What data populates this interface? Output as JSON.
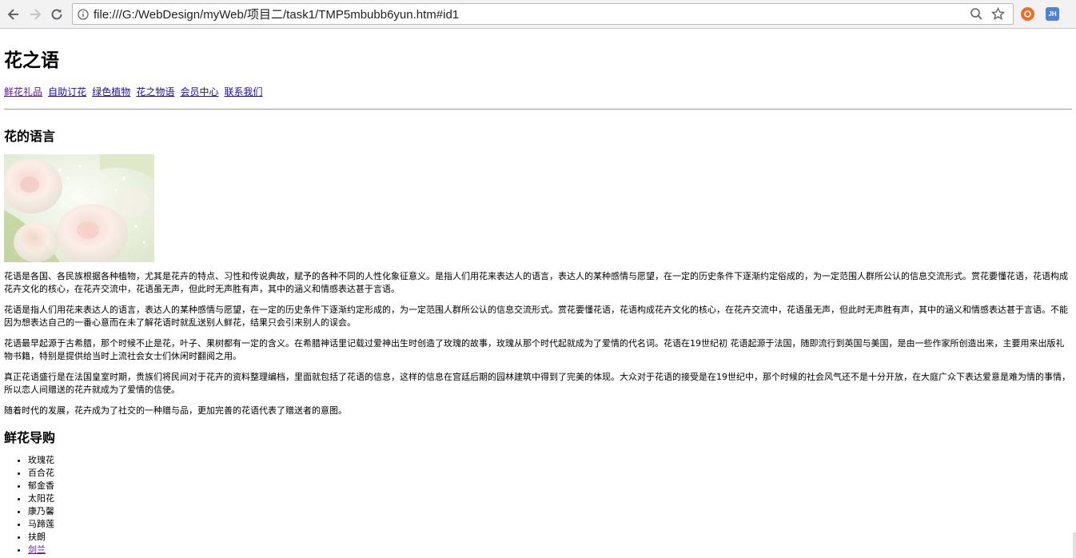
{
  "browser": {
    "url": "file:///G:/WebDesign/myWeb/项目二/task1/TMP5mbubb6yun.htm#id1",
    "extension_badge": "JH"
  },
  "page": {
    "title": "花之语",
    "nav": [
      "鲜花礼品",
      "自助订花",
      "绿色植物",
      "花之物语",
      "会员中心",
      "联系我们"
    ],
    "section1_heading": "花的语言",
    "paragraphs": [
      "花语是各国、各民族根据各种植物，尤其是花卉的特点、习性和传说典故，赋予的各种不同的人性化象征意义。是指人们用花来表达人的语言，表达人的某种感情与愿望，在一定的历史条件下逐渐约定俗成的，为一定范围人群所公认的信息交流形式。赏花要懂花语，花语构成花卉文化的核心，在花卉交流中，花语虽无声，但此时无声胜有声，其中的涵义和情感表达甚于言语。",
      "花语是指人们用花来表达人的语言，表达人的某种感情与愿望，在一定的历史条件下逐渐约定形成的，为一定范围人群所公认的信息交流形式。赏花要懂花语，花语构成花卉文化的核心，在花卉交流中，花语虽无声，但此时无声胜有声，其中的涵义和情感表达甚于言语。不能因为想表达自己的一番心意而在未了解花语时就乱送别人鲜花，结果只会引来别人的误会。",
      "花语最早起源于古希腊，那个时候不止是花，叶子、果树都有一定的含义。在希腊神话里记载过爱神出生时创造了玫瑰的故事，玫瑰从那个时代起就成为了爱情的代名词。花语在19世纪初 花语起源于法国，随即流行到英国与美国，是由一些作家所创造出来，主要用来出版礼物书籍，特别是提供给当时上流社会女士们休闲时翻阅之用。",
      "真正花语盛行是在法国皇室时期，贵族们将民间对于花卉的资料整理编档，里面就包括了花语的信息，这样的信息在宫廷后期的园林建筑中得到了完美的体现。大众对于花语的接受是在19世纪中，那个时候的社会风气还不是十分开放，在大庭广众下表达爱意是难为情的事情，所以恋人间赠送的花卉就成为了爱情的信使。",
      "随着时代的发展，花卉成为了社交的一种赠与品，更加完善的花语代表了赠送者的意图。"
    ],
    "section2_heading": "鲜花导购",
    "flowers": [
      "玫瑰花",
      "百合花",
      "郁金香",
      "太阳花",
      "康乃馨",
      "马蹄莲",
      "扶朗",
      "剑兰"
    ]
  }
}
